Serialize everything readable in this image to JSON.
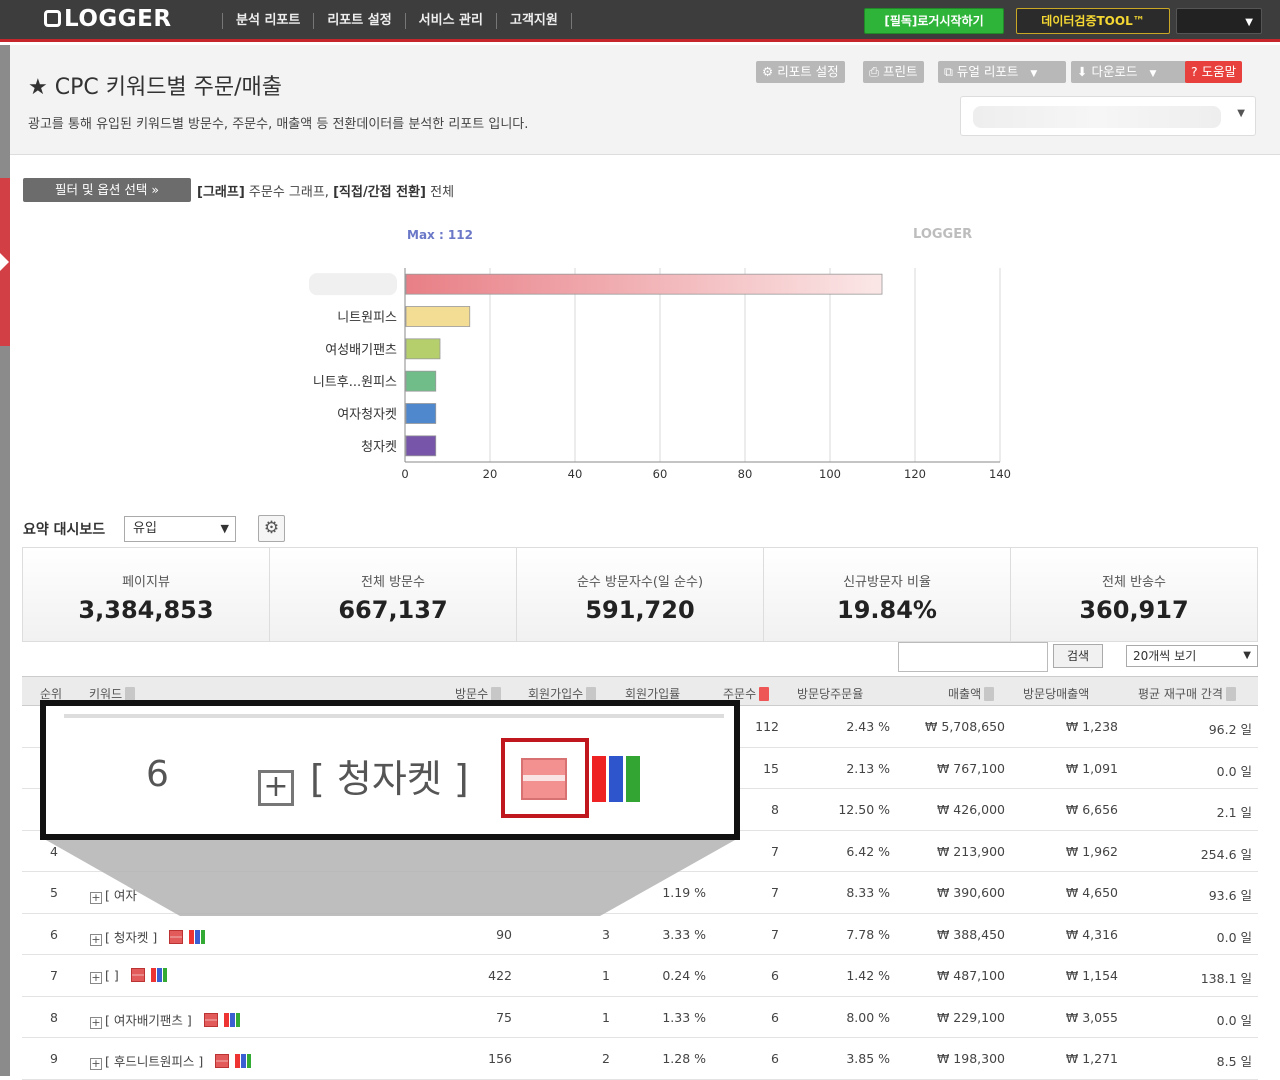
{
  "topbar": {
    "logo": "LOGGER",
    "nav": [
      "분석 리포트",
      "리포트 설정",
      "서비스 관리",
      "고객지원"
    ],
    "start_button": "[필독]로거시작하기",
    "tool_button": "데이터검증TOOL™"
  },
  "header": {
    "title": "CPC 키워드별 주문/매출",
    "description": "광고를 통해 유입된 키워드별 방문수, 주문수, 매출액 등 전환데이터를 분석한 리포트 입니다.",
    "tools": [
      {
        "label": "리포트 설정",
        "icon": "gear-icon"
      },
      {
        "label": "프린트",
        "icon": "print-icon"
      },
      {
        "label": "듀얼 리포트",
        "icon": "dual-icon"
      },
      {
        "label": "다운로드",
        "icon": "download-icon"
      },
      {
        "label": "도움말",
        "icon": "help-icon"
      }
    ]
  },
  "filter": {
    "button": "필터 및 옵션 선택",
    "graph_tag": "[그래프]",
    "graph_value": "주문수 그래프,",
    "conv_tag": "[직접/간접 전환]",
    "conv_value": "전체"
  },
  "chart_data": {
    "type": "bar",
    "orientation": "horizontal",
    "max_label": "Max : 112",
    "watermark": "LOGGER",
    "categories": [
      "",
      "니트원피스",
      "여성배기팬츠",
      "니트후...원피스",
      "여자청자켓",
      "청자켓"
    ],
    "values": [
      112,
      15,
      8,
      7,
      7,
      7
    ],
    "colors": [
      "#e87f86",
      "#f3dc93",
      "#b5cf6c",
      "#70bd8a",
      "#4f88cc",
      "#7756aa"
    ],
    "xlim": [
      0,
      140
    ],
    "xticks": [
      0,
      20,
      40,
      60,
      80,
      100,
      120,
      140
    ]
  },
  "dashboard": {
    "label": "요약 대시보드",
    "select": "유입",
    "stats": [
      {
        "label": "페이지뷰",
        "value": "3,384,853"
      },
      {
        "label": "전체 방문수",
        "value": "667,137"
      },
      {
        "label": "순수 방문자수(일 순수)",
        "value": "591,720"
      },
      {
        "label": "신규방문자 비율",
        "value": "19.84%"
      },
      {
        "label": "전체 반송수",
        "value": "360,917"
      }
    ]
  },
  "table_controls": {
    "search_button": "검색",
    "page_size": "20개씩 보기"
  },
  "table": {
    "headers": [
      "순위",
      "키워드",
      "방문수",
      "회원가입수",
      "회원가입률",
      "주문수",
      "방문당주문율",
      "매출액",
      "방문당매출액",
      "평균 재구매 간격"
    ],
    "rows": [
      {
        "rank": "",
        "keyword": "",
        "visits": "",
        "signups": "",
        "signup_rate": "",
        "orders": "112",
        "order_rate": "2.43 %",
        "sales": "₩ 5,708,650",
        "sales_per_visit": "₩ 1,238",
        "repurchase": "96.2 일"
      },
      {
        "rank": "",
        "keyword": "",
        "visits": "",
        "signups": "",
        "signup_rate": "",
        "orders": "15",
        "order_rate": "2.13 %",
        "sales": "₩ 767,100",
        "sales_per_visit": "₩ 1,091",
        "repurchase": "0.0 일"
      },
      {
        "rank": "",
        "keyword": "",
        "visits": "",
        "signups": "",
        "signup_rate": "",
        "orders": "8",
        "order_rate": "12.50 %",
        "sales": "₩ 426,000",
        "sales_per_visit": "₩ 6,656",
        "repurchase": "2.1 일"
      },
      {
        "rank": "4",
        "keyword": "",
        "visits": "",
        "signups": "",
        "signup_rate": "",
        "orders": "7",
        "order_rate": "6.42 %",
        "sales": "₩ 213,900",
        "sales_per_visit": "₩ 1,962",
        "repurchase": "254.6 일"
      },
      {
        "rank": "5",
        "keyword": "[ 여자",
        "visits": "",
        "signups": "",
        "signup_rate": "1.19 %",
        "orders": "7",
        "order_rate": "8.33 %",
        "sales": "₩ 390,600",
        "sales_per_visit": "₩ 4,650",
        "repurchase": "93.6 일"
      },
      {
        "rank": "6",
        "keyword": "[ 청자켓 ]",
        "visits": "90",
        "signups": "3",
        "signup_rate": "3.33 %",
        "orders": "7",
        "order_rate": "7.78 %",
        "sales": "₩ 388,450",
        "sales_per_visit": "₩ 4,316",
        "repurchase": "0.0 일"
      },
      {
        "rank": "7",
        "keyword": "[ ]",
        "visits": "422",
        "signups": "1",
        "signup_rate": "0.24 %",
        "orders": "6",
        "order_rate": "1.42 %",
        "sales": "₩ 487,100",
        "sales_per_visit": "₩ 1,154",
        "repurchase": "138.1 일"
      },
      {
        "rank": "8",
        "keyword": "[ 여자배기팬츠 ]",
        "visits": "75",
        "signups": "1",
        "signup_rate": "1.33 %",
        "orders": "6",
        "order_rate": "8.00 %",
        "sales": "₩ 229,100",
        "sales_per_visit": "₩ 3,055",
        "repurchase": "0.0 일"
      },
      {
        "rank": "9",
        "keyword": "[ 후드니트원피스 ]",
        "visits": "156",
        "signups": "2",
        "signup_rate": "1.28 %",
        "orders": "6",
        "order_rate": "3.85 %",
        "sales": "₩ 198,300",
        "sales_per_visit": "₩ 1,271",
        "repurchase": "8.5 일"
      }
    ]
  },
  "zoom": {
    "rank": "6",
    "keyword": "[ 청자켓 ]"
  }
}
